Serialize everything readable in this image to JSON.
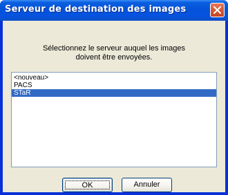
{
  "dialog": {
    "title": "Serveur de destination des images",
    "prompt_line1": "Sélectionnez le serveur auquel les images",
    "prompt_line2": "doivent être envoyées.",
    "close_icon": "close-x-icon"
  },
  "servers": {
    "items": [
      {
        "label": "<nouveau>",
        "selected": false
      },
      {
        "label": "PACS",
        "selected": false
      },
      {
        "label": "STaR",
        "selected": true
      }
    ]
  },
  "buttons": {
    "ok_label": "OK",
    "cancel_label": "Annuler"
  },
  "colors": {
    "title_bar": "#0453d8",
    "selection": "#316ac5",
    "client_bg": "#ece9d8"
  }
}
